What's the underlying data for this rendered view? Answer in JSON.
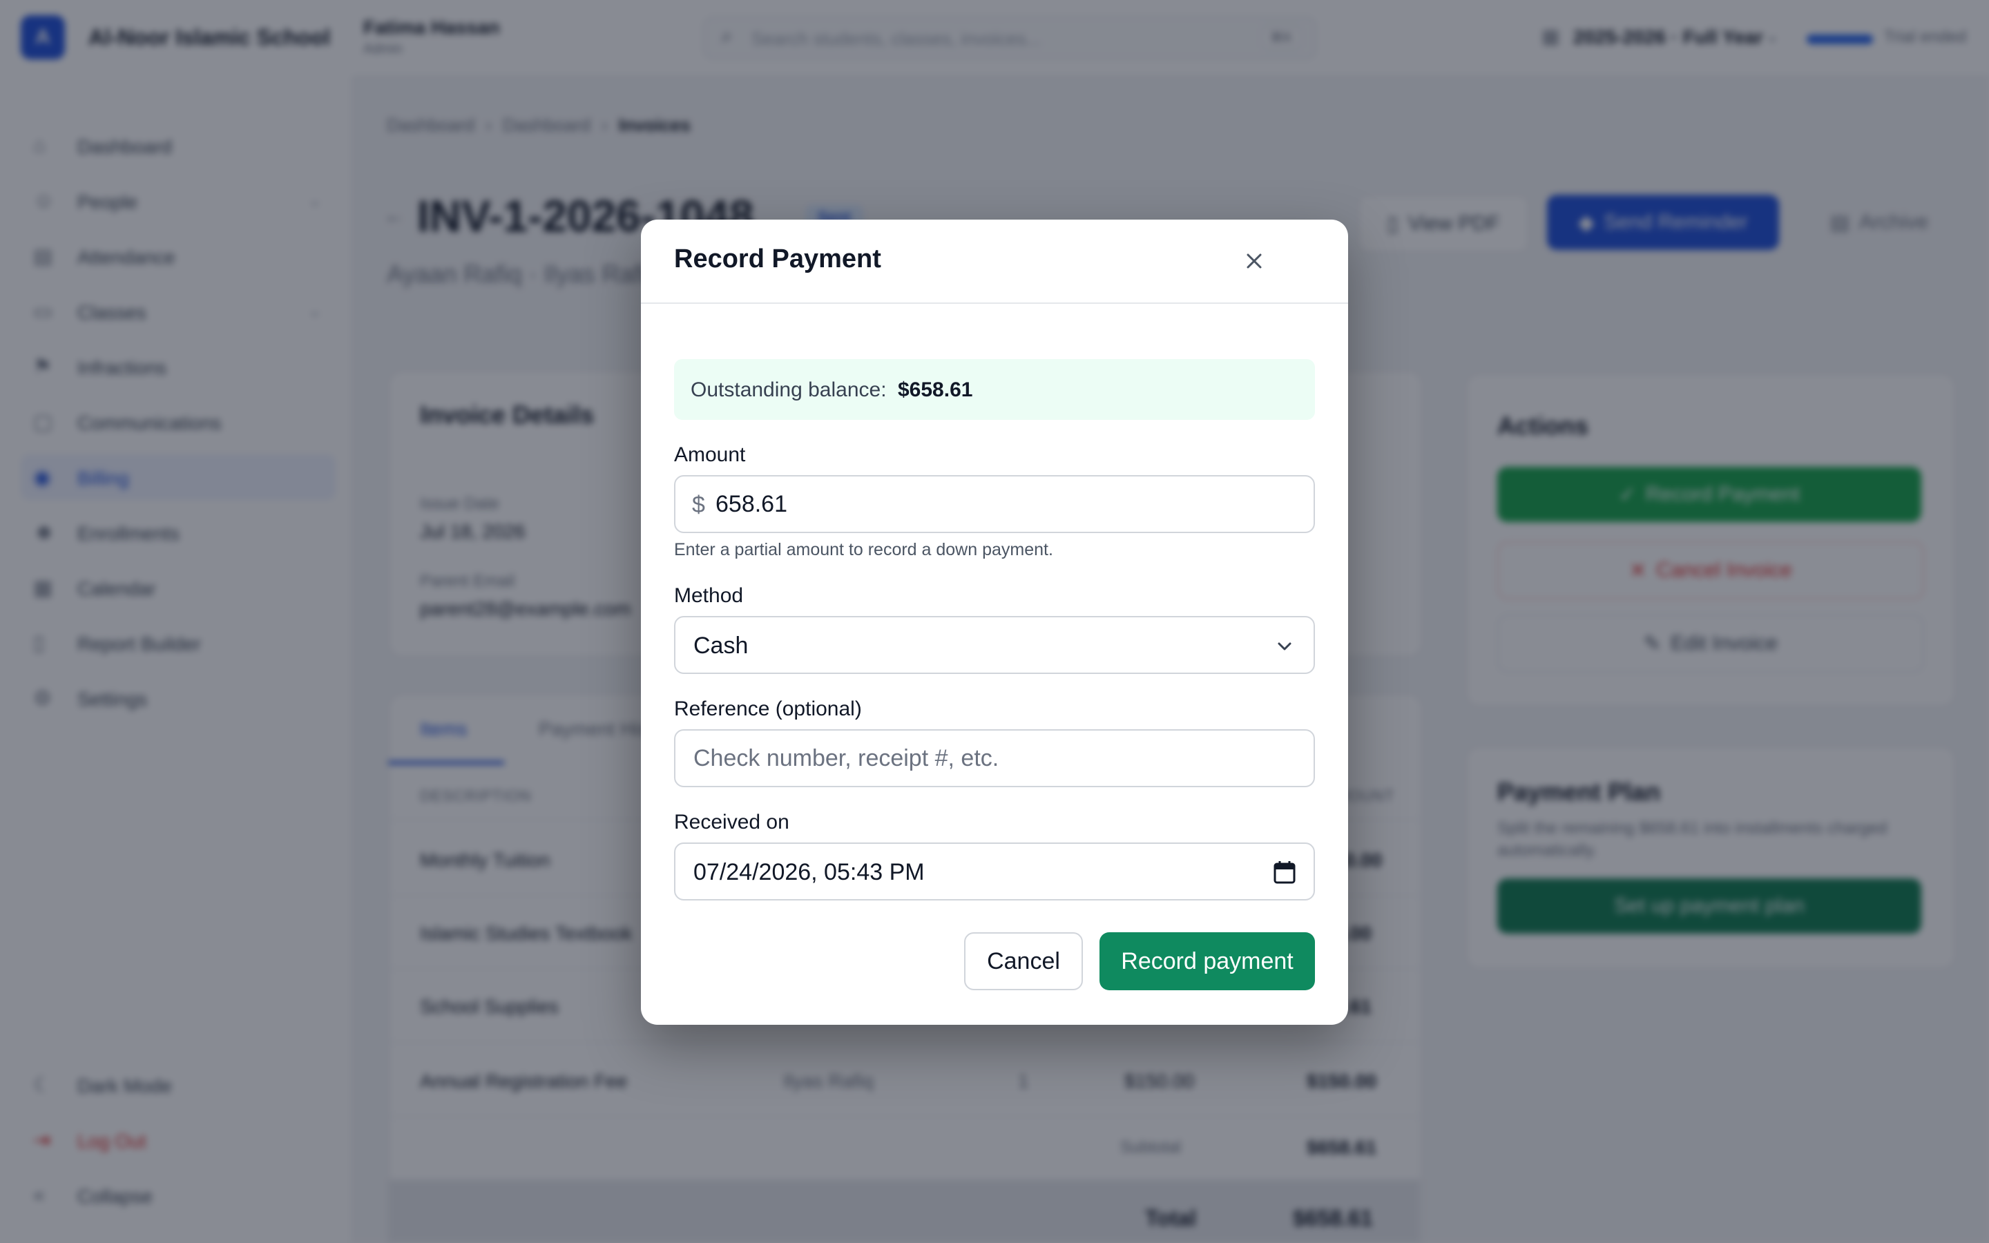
{
  "topbar": {
    "school_initial": "A",
    "school_name": "Al-Noor Islamic School",
    "user_name": "Fatima Hassan",
    "user_role": "Admin",
    "search_placeholder": "Search students, classes, invoices...",
    "search_shortcut": "⌘K",
    "academic_year": "2025-2026 · Full Year",
    "trial_text": "Trial ended"
  },
  "sidebar": {
    "items": [
      {
        "label": "Dashboard",
        "icon": "home-icon"
      },
      {
        "label": "People",
        "icon": "users-icon"
      },
      {
        "label": "Attendance",
        "icon": "clipboard-icon"
      },
      {
        "label": "Classes",
        "icon": "book-icon"
      },
      {
        "label": "Infractions",
        "icon": "flag-icon"
      },
      {
        "label": "Communications",
        "icon": "message-icon"
      },
      {
        "label": "Billing",
        "icon": "dollar-icon"
      },
      {
        "label": "Enrollments",
        "icon": "user-plus-icon"
      },
      {
        "label": "Calendar",
        "icon": "calendar-icon"
      },
      {
        "label": "Report Builder",
        "icon": "file-icon"
      },
      {
        "label": "Settings",
        "icon": "gear-icon"
      }
    ],
    "bottom": [
      {
        "label": "Dark Mode",
        "icon": "moon-icon"
      },
      {
        "label": "Log Out",
        "icon": "logout-icon"
      },
      {
        "label": "Collapse",
        "icon": "collapse-icon"
      }
    ]
  },
  "page": {
    "breadcrumb": [
      "Dashboard",
      "Dashboard",
      "Invoices"
    ],
    "invoice_number": "INV-1-2026-1048",
    "status_badge": "Sent",
    "subtitle": "Ayaan Rafiq · Ilyas Rafiq",
    "view_pdf_label": "View PDF",
    "send_reminder_label": "Send Reminder",
    "archive_label": "Archive",
    "details_title": "Invoice Details",
    "issue_date_label": "Issue Date",
    "issue_date_value": "Jul 18, 2026",
    "parent_email_label": "Parent Email",
    "parent_email_value": "parent28@example.com",
    "tabs": [
      "Items",
      "Payment History"
    ],
    "table_headers": [
      "DESCRIPTION",
      "AMOUNT"
    ],
    "rows": [
      {
        "description": "Monthly Tuition",
        "student": "",
        "qty": "",
        "price": "",
        "amount": "$250.00"
      },
      {
        "description": "Islamic Studies Textbook",
        "student": "",
        "qty": "",
        "price": "",
        "amount": "$45.00"
      },
      {
        "description": "School Supplies",
        "student": "",
        "qty": "",
        "price": "",
        "amount": "$63.61"
      },
      {
        "description": "Annual Registration Fee",
        "student": "Ilyas Rafiq",
        "qty": "1",
        "price": "$150.00",
        "amount": "$150.00"
      }
    ],
    "subtotal_label": "Subtotal",
    "subtotal_value": "$658.61",
    "total_label": "Total",
    "total_value": "$658.61",
    "actions_title": "Actions",
    "record_payment_label": "Record Payment",
    "cancel_invoice_label": "Cancel Invoice",
    "edit_invoice_label": "Edit Invoice",
    "plan_title": "Payment Plan",
    "plan_description": "Split the remaining $658.61 into installments charged automatically.",
    "plan_button": "Set up payment plan"
  },
  "modal": {
    "title": "Record Payment",
    "close_icon": "close-icon",
    "balance_label": "Outstanding balance:",
    "balance_amount": "$658.61",
    "amount_label": "Amount",
    "currency_symbol": "$",
    "amount_value": "658.61",
    "amount_helper": "Enter a partial amount to record a down payment.",
    "method_label": "Method",
    "method_value": "Cash",
    "reference_label": "Reference (optional)",
    "reference_value": "",
    "reference_placeholder": "Check number, receipt #, etc.",
    "received_label": "Received on",
    "received_value": "07/24/2026, 05:43 PM",
    "cancel_label": "Cancel",
    "submit_label": "Record payment"
  },
  "colors": {
    "primary_green": "#0f8a5f",
    "balance_bg": "#ecfdf5",
    "brand_blue": "#1d4ed8",
    "overlay": "rgba(17,24,39,0.5)"
  }
}
